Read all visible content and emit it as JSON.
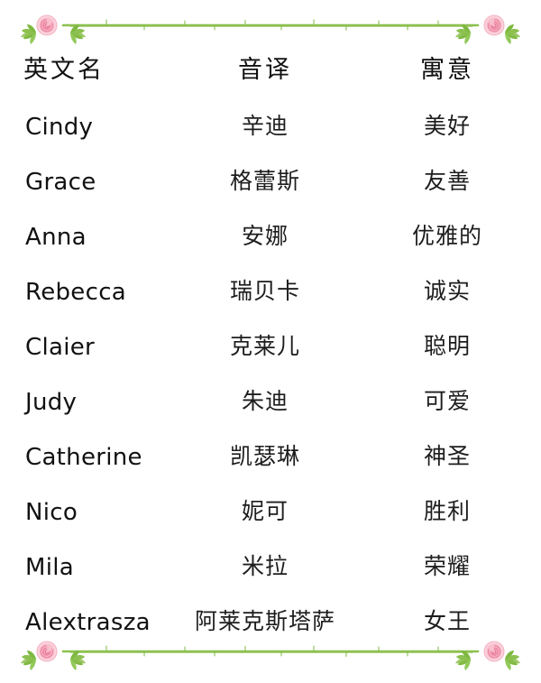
{
  "page": {
    "background_color": "#ffffff",
    "text_color": "#111111"
  },
  "decoration": {
    "top_divider_name": "floral-divider-top",
    "bottom_divider_name": "floral-divider-bottom",
    "motif": "rose-and-leaves",
    "rose_color": "#f4a9bc",
    "rose_light_color": "#fbd3dd",
    "rose_dark_color": "#ef8ca6",
    "leaf_color": "#8cc04f",
    "line_color": "#8cc04f"
  },
  "table": {
    "columns": [
      {
        "key": "name",
        "label": "英文名"
      },
      {
        "key": "translit",
        "label": "音译"
      },
      {
        "key": "meaning",
        "label": "寓意"
      }
    ],
    "rows": [
      {
        "name": "Cindy",
        "translit": "辛迪",
        "meaning": "美好"
      },
      {
        "name": "Grace",
        "translit": "格蕾斯",
        "meaning": "友善"
      },
      {
        "name": "Anna",
        "translit": "安娜",
        "meaning": "优雅的"
      },
      {
        "name": "Rebecca",
        "translit": "瑞贝卡",
        "meaning": "诚实"
      },
      {
        "name": "Claier",
        "translit": "克莱儿",
        "meaning": "聪明"
      },
      {
        "name": "Judy",
        "translit": "朱迪",
        "meaning": "可爱"
      },
      {
        "name": "Catherine",
        "translit": "凯瑟琳",
        "meaning": "神圣"
      },
      {
        "name": "Nico",
        "translit": "妮可",
        "meaning": "胜利"
      },
      {
        "name": "Mila",
        "translit": "米拉",
        "meaning": "荣耀"
      },
      {
        "name": "Alextrasza",
        "translit": "阿莱克斯塔萨",
        "meaning": "女王"
      }
    ]
  }
}
